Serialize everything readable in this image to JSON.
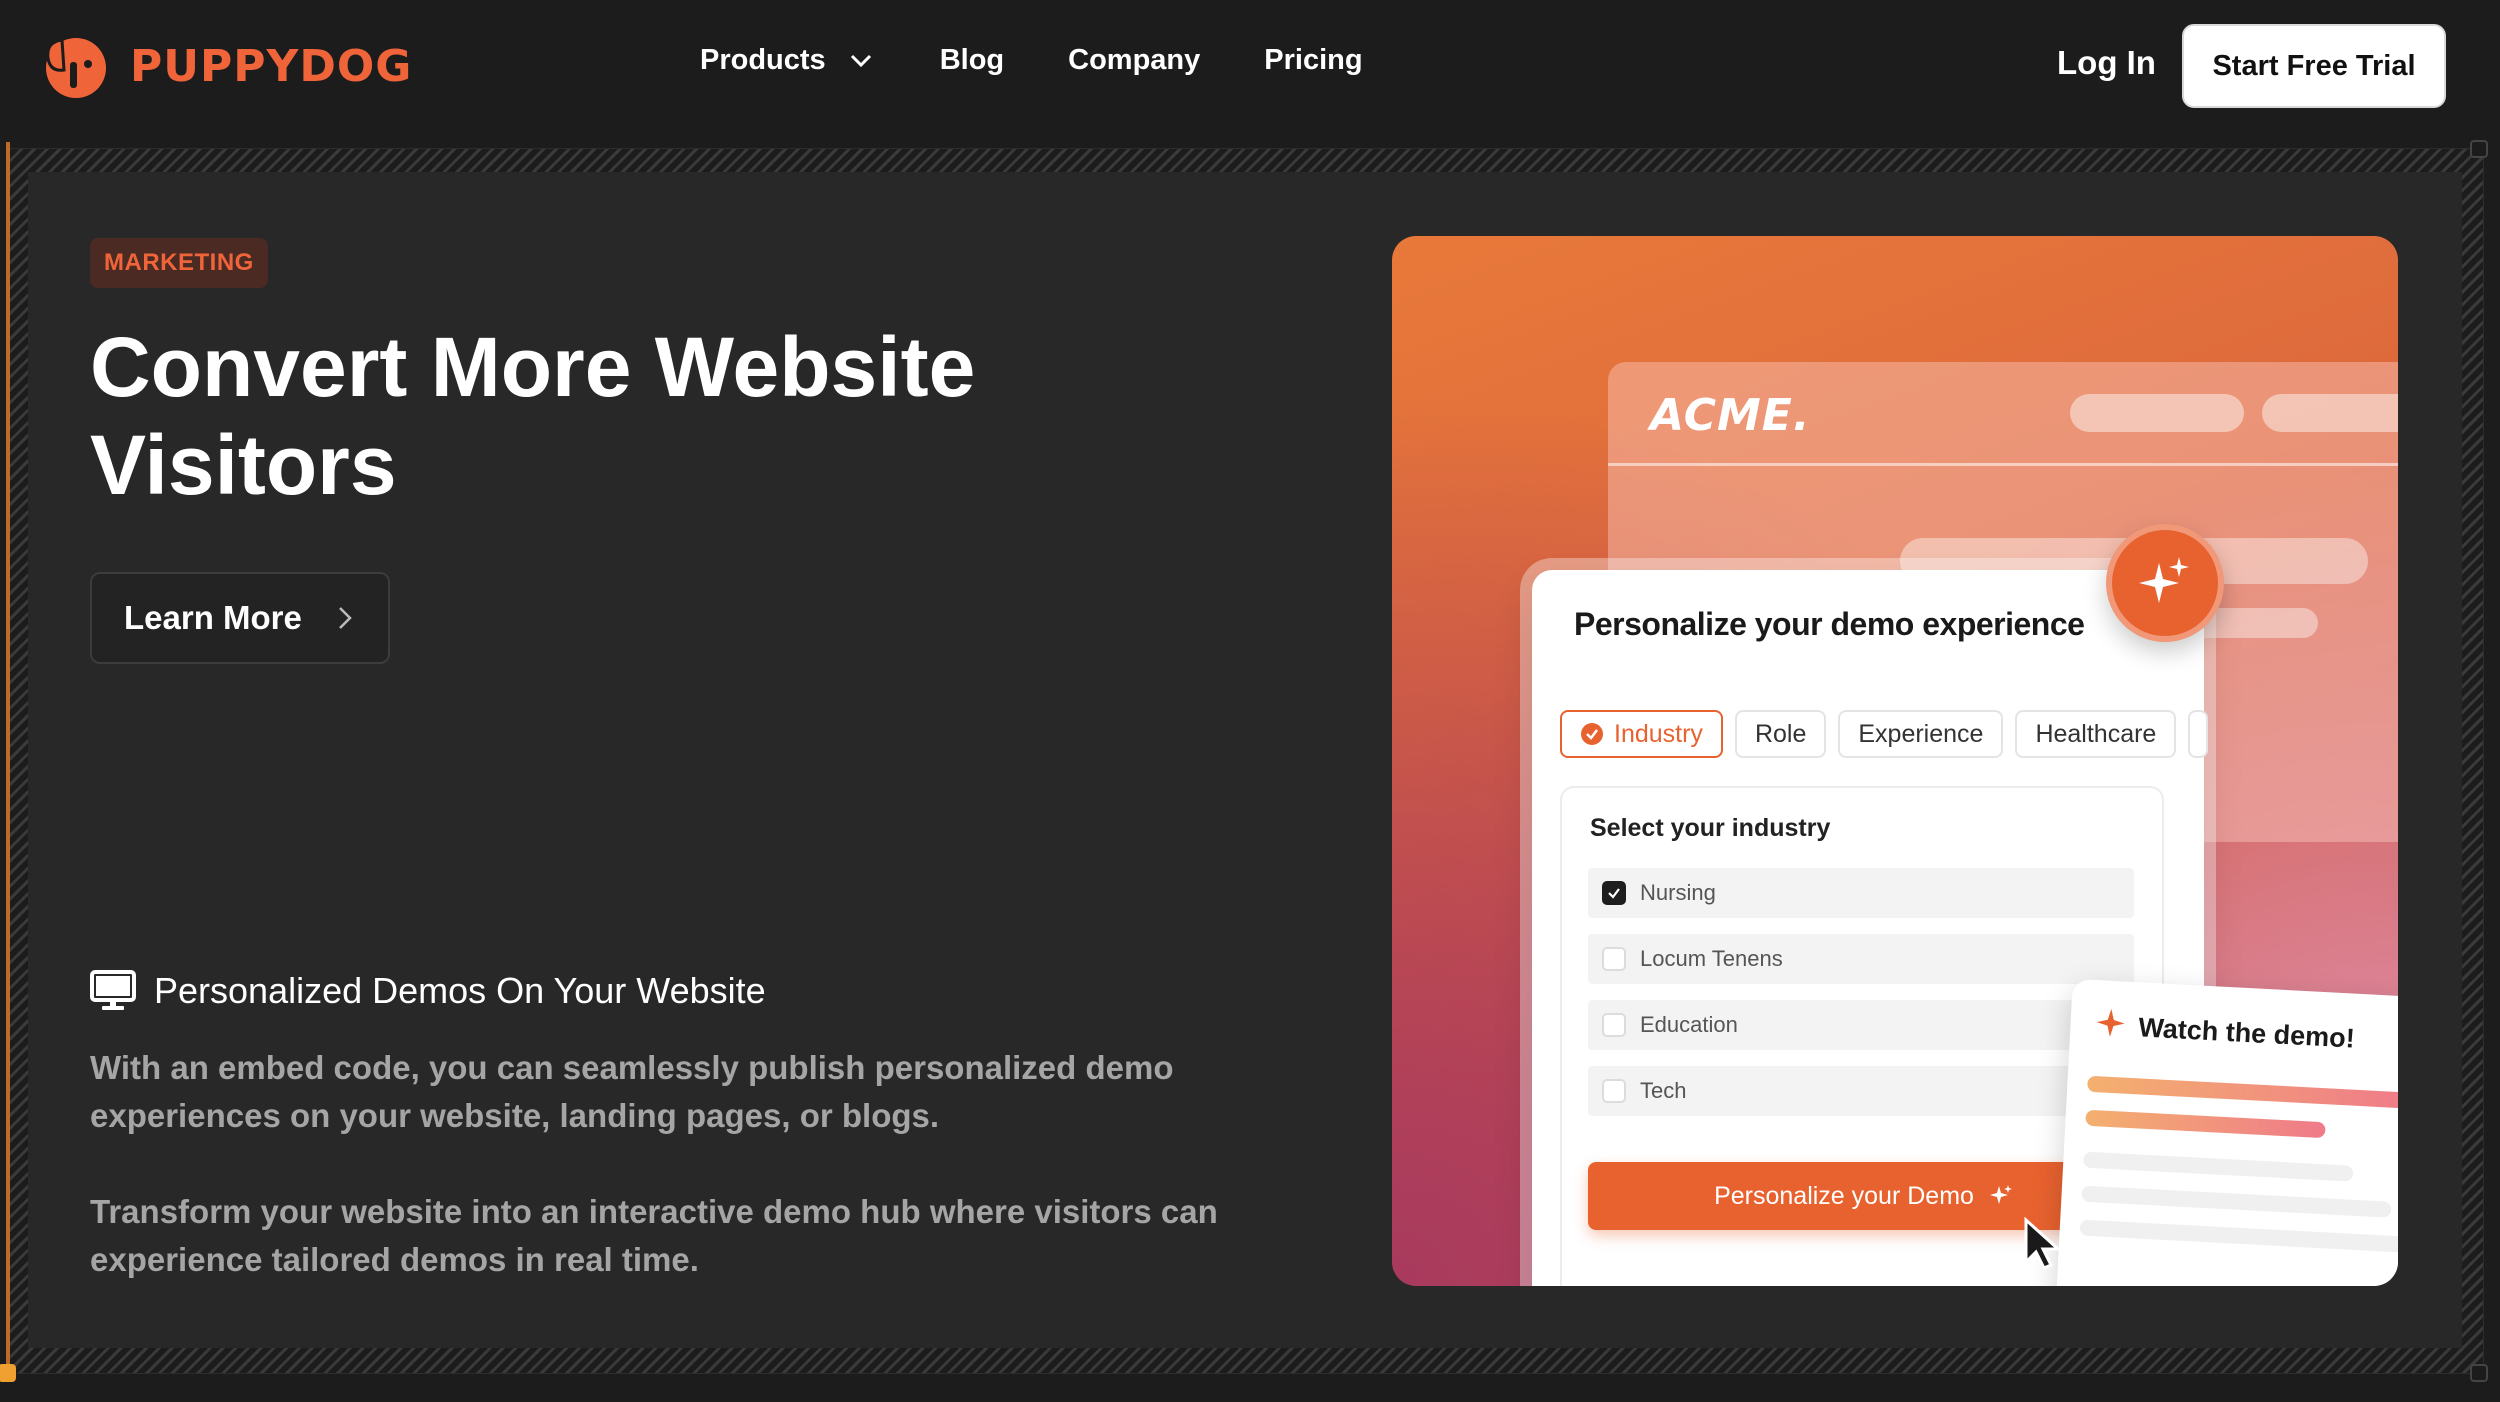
{
  "brand": {
    "name": "PuppyDog",
    "accent": "#f0643a"
  },
  "nav": {
    "links": [
      "Products",
      "Blog",
      "Company",
      "Pricing"
    ],
    "login": "Log In",
    "cta": "Start Free Trial"
  },
  "hero": {
    "tag": "MARKETING",
    "headline": "Convert More Website Visitors",
    "button": "Learn More",
    "feature_title": "Personalized Demos On Your Website",
    "paragraph_1": "With an embed code, you can seamlessly publish personalized demo experiences on your website, landing pages, or blogs.",
    "paragraph_2": "Transform your website into an interactive demo hub where visitors can experience tailored demos in real time."
  },
  "illustration": {
    "acme_logo": "ACME.",
    "card_title": "Personalize your demo experience",
    "chips": [
      "Industry",
      "Role",
      "Experience",
      "Healthcare"
    ],
    "select_label": "Select your industry",
    "options": [
      {
        "label": "Nursing",
        "checked": true
      },
      {
        "label": "Locum Tenens",
        "checked": false
      },
      {
        "label": "Education",
        "checked": false
      },
      {
        "label": "Tech",
        "checked": false
      }
    ],
    "cta": "Personalize your Demo",
    "watch_title": "Watch the demo!"
  },
  "icons": [
    "puppydog-logo-icon",
    "chevron-down-icon",
    "chevron-right-icon",
    "monitor-icon",
    "check-circle-icon",
    "sparkle-icon",
    "star-icon",
    "cursor-icon"
  ]
}
